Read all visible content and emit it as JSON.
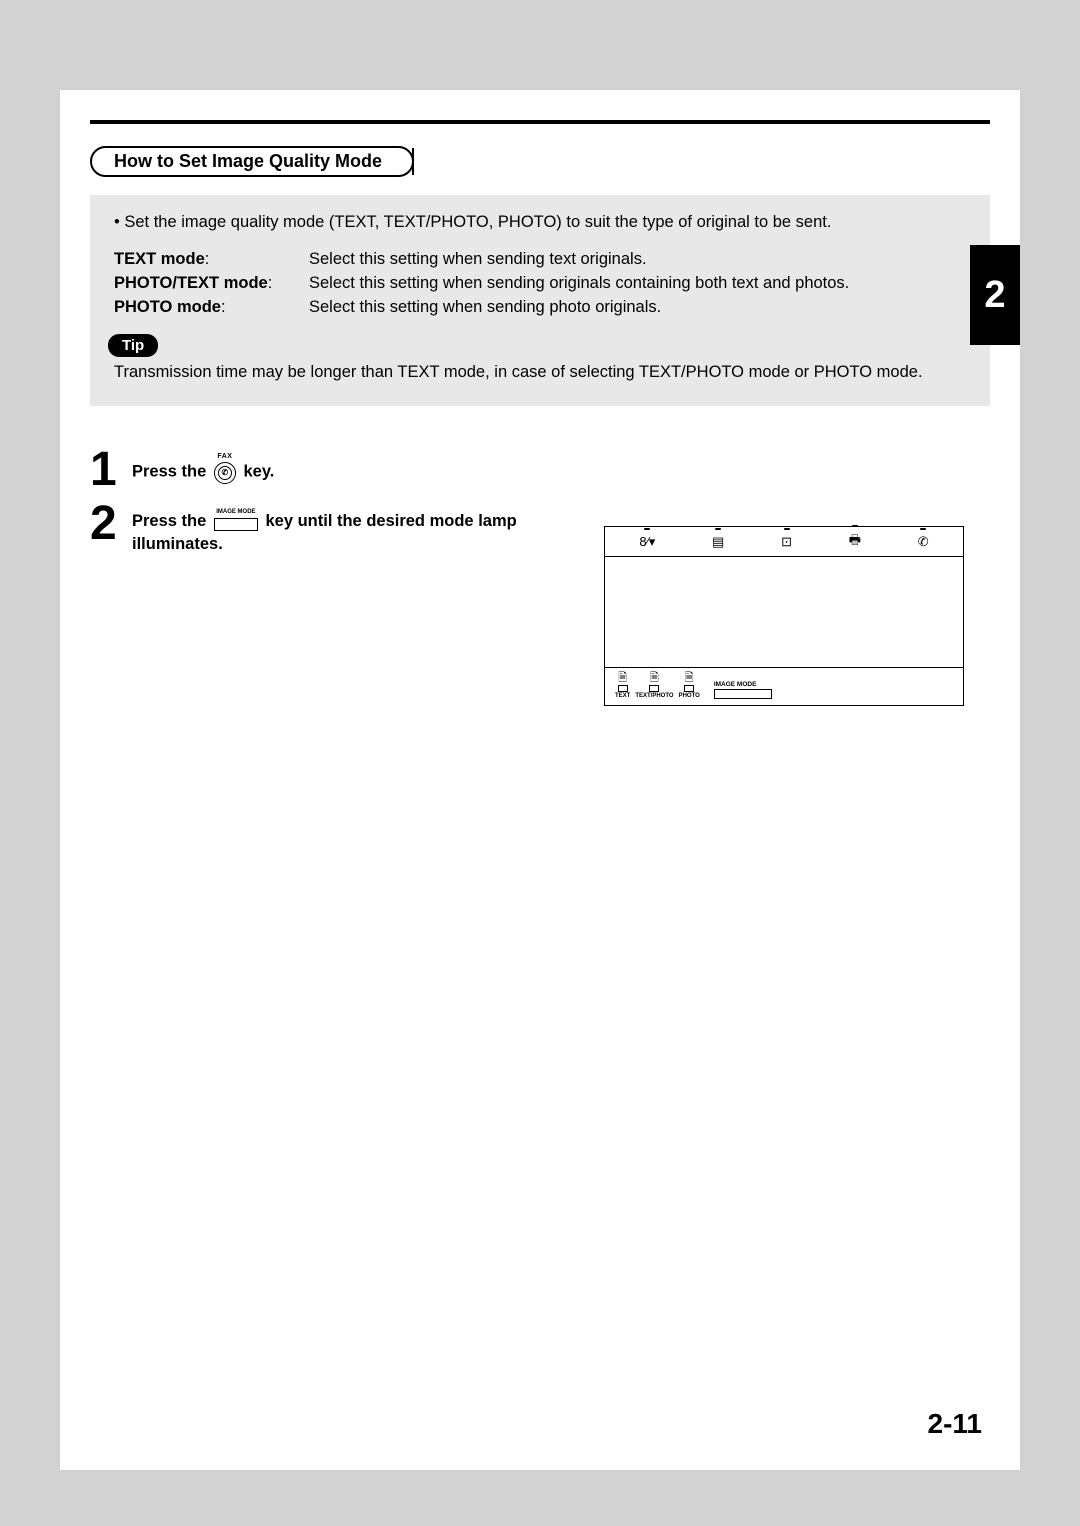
{
  "chapter_tab": "2",
  "page_number": "2-11",
  "section_title": "How to Set Image Quality Mode",
  "intro_bullet": "Set the image quality mode (TEXT, TEXT/PHOTO, PHOTO) to suit the type of original to be sent.",
  "modes": [
    {
      "term": "TEXT mode",
      "desc": "Select this setting when sending text originals."
    },
    {
      "term": "PHOTO/TEXT mode",
      "desc": "Select this setting when sending originals containing both text and photos."
    },
    {
      "term": "PHOTO mode",
      "desc": "Select this setting when sending photo originals."
    }
  ],
  "tip": {
    "label": "Tip",
    "text": "Transmission time may be longer than TEXT mode, in case of selecting TEXT/PHOTO mode or PHOTO mode."
  },
  "step1": {
    "pre": "Press the ",
    "post": " key.",
    "btn_label": "FAX"
  },
  "step2": {
    "pre": "Press the ",
    "mid": " key until the desired mode lamp illuminates.",
    "btn_label": "IMAGE MODE"
  },
  "panel": {
    "image_mode_label": "IMAGE MODE",
    "mode_labels": [
      "TEXT",
      "TEXT/PHOTO",
      "PHOTO"
    ]
  }
}
